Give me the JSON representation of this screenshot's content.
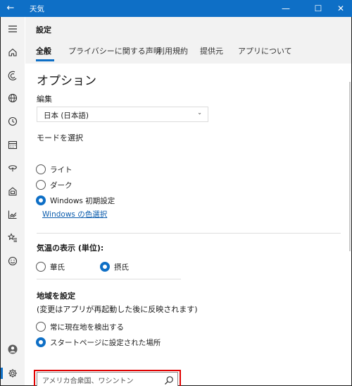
{
  "window": {
    "title": "天気",
    "back_icon": "←",
    "minimize_icon": "—",
    "maximize_icon": "☐",
    "close_icon": "✕",
    "accent": "#0e6fc6"
  },
  "rail": {
    "icons": [
      "menu-icon",
      "home-icon",
      "forecast-icon",
      "globe-icon",
      "clock-icon",
      "calendar-icon",
      "life-icon",
      "news-icon",
      "chart-icon",
      "favorites-icon",
      "smiley-icon",
      "account-icon",
      "settings-icon"
    ]
  },
  "page": {
    "title": "設定",
    "tabs": [
      {
        "label": "全般"
      },
      {
        "label": "プライバシーに関する声明"
      },
      {
        "label": "利用規約"
      },
      {
        "label": "提供元"
      },
      {
        "label": "アプリについて"
      }
    ]
  },
  "options": {
    "heading": "オプション",
    "edit_label": "編集",
    "language_value": "日本 (日本語)",
    "mode_label": "モードを選択",
    "mode_options": [
      {
        "label": "ライト",
        "checked": false
      },
      {
        "label": "ダーク",
        "checked": false
      },
      {
        "label": "Windows 初期設定",
        "checked": true
      }
    ],
    "color_link": "Windows の色選択",
    "temp_label": "気温の表示 (単位):",
    "temp_options": [
      {
        "label": "華氏",
        "checked": false
      },
      {
        "label": "摂氏",
        "checked": true
      }
    ],
    "region_label": "地域を設定",
    "region_note": "(変更はアプリが再起動した後に反映されます)",
    "region_options": [
      {
        "label": "常に現在地を検出する",
        "checked": false
      },
      {
        "label": "スタートページに設定された場所",
        "checked": true
      }
    ],
    "location_value": "アメリカ合衆国、ワシントン"
  }
}
